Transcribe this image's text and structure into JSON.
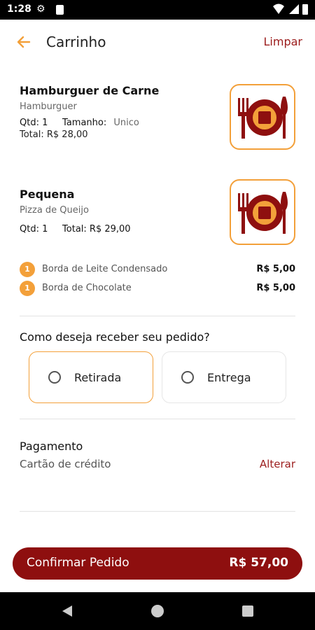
{
  "status_bar": {
    "time": "1:28"
  },
  "header": {
    "title": "Carrinho",
    "clear_label": "Limpar"
  },
  "items": [
    {
      "name": "Hamburguer de Carne",
      "category": "Hamburguer",
      "qty_label": "Qtd: 1",
      "size_label": "Tamanho:",
      "size_value": "Unico",
      "total": "Total: R$ 28,00",
      "icon": "restaurant-plate-icon"
    },
    {
      "name": "Pequena",
      "category": "Pizza de Queijo",
      "qty_label": "Qtd: 1",
      "total": "Total: R$ 29,00",
      "icon": "restaurant-plate-icon"
    }
  ],
  "addons": [
    {
      "qty": "1",
      "name": "Borda de Leite Condensado",
      "price": "R$ 5,00"
    },
    {
      "qty": "1",
      "name": "Borda de Chocolate",
      "price": "R$ 5,00"
    }
  ],
  "delivery": {
    "question": "Como deseja receber seu pedido?",
    "options": [
      {
        "label": "Retirada",
        "selected": true
      },
      {
        "label": "Entrega",
        "selected": false
      }
    ]
  },
  "payment": {
    "title": "Pagamento",
    "method": "Cartão de crédito",
    "change_label": "Alterar"
  },
  "confirm": {
    "label": "Confirmar Pedido",
    "total": "R$ 57,00"
  },
  "colors": {
    "accent": "#f3a03a",
    "brand": "#8e0f0f",
    "link": "#9b1c1c"
  }
}
